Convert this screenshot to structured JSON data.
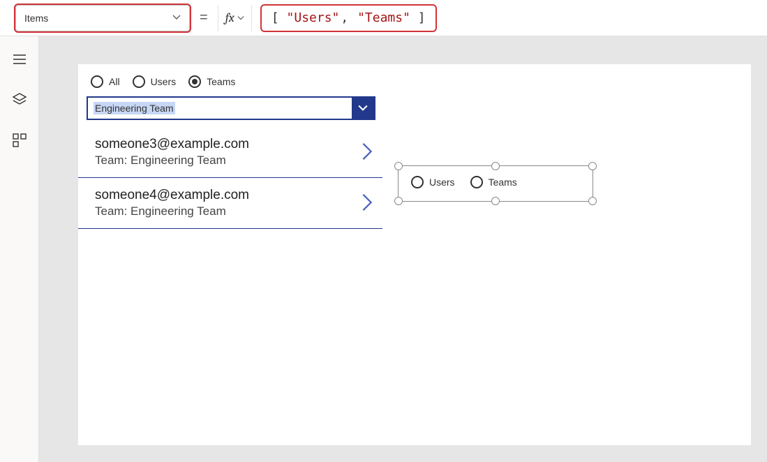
{
  "formula_bar": {
    "property_name": "Items",
    "equals": "=",
    "fx_label": "fx",
    "formula_tokens": {
      "open": "[",
      "str1": "\"Users\"",
      "comma": ",",
      "str2": "\"Teams\"",
      "close": "]"
    }
  },
  "left_rail": {
    "hamburger_title": "Tree view",
    "layers_title": "Layers",
    "components_title": "Components"
  },
  "app": {
    "radios_top": [
      {
        "label": "All",
        "checked": false
      },
      {
        "label": "Users",
        "checked": false
      },
      {
        "label": "Teams",
        "checked": true
      }
    ],
    "dropdown_value": "Engineering Team",
    "list": [
      {
        "primary": "someone3@example.com",
        "secondary": "Team: Engineering Team"
      },
      {
        "primary": "someone4@example.com",
        "secondary": "Team: Engineering Team"
      }
    ],
    "selected_control_radios": [
      {
        "label": "Users",
        "checked": false
      },
      {
        "label": "Teams",
        "checked": false
      }
    ]
  }
}
